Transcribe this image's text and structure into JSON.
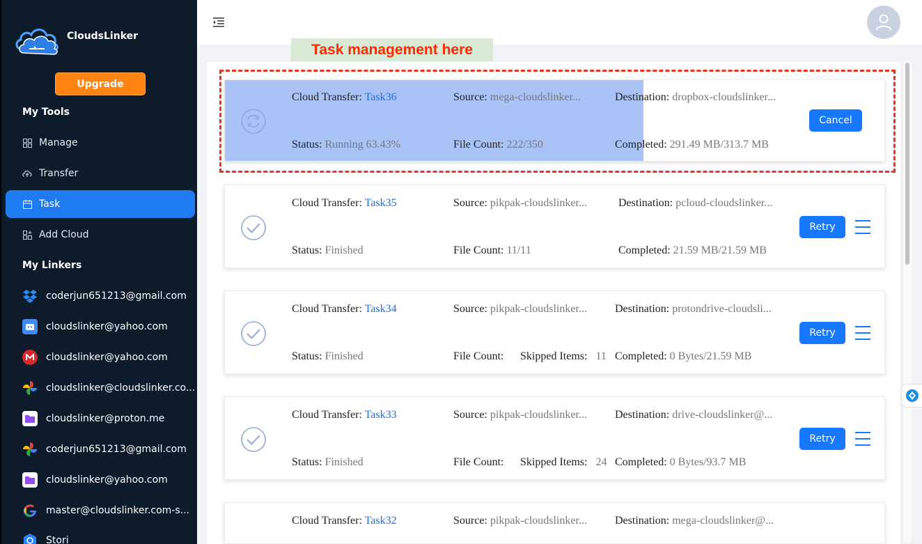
{
  "app": {
    "brand": "CloudsLinker",
    "upgrade_label": "Upgrade"
  },
  "sidebar": {
    "tools_title": "My Tools",
    "tools": [
      {
        "label": "Manage",
        "icon": "grid-icon"
      },
      {
        "label": "Transfer",
        "icon": "cloud-transfer-icon"
      },
      {
        "label": "Task",
        "icon": "calendar-icon",
        "active": true
      },
      {
        "label": "Add Cloud",
        "icon": "add-grid-icon"
      }
    ],
    "linkers_title": "My Linkers",
    "linkers": [
      {
        "label": "coderjun651213@gmail.com",
        "icon": "dropbox-icon"
      },
      {
        "label": "cloudslinker@yahoo.com",
        "icon": "pikpak-icon"
      },
      {
        "label": "cloudslinker@yahoo.com",
        "icon": "mega-icon"
      },
      {
        "label": "cloudslinker@cloudslinker.co...",
        "icon": "google-photos-icon"
      },
      {
        "label": "cloudslinker@proton.me",
        "icon": "proton-drive-icon"
      },
      {
        "label": "coderjun651213@gmail.com",
        "icon": "google-photos-icon"
      },
      {
        "label": "cloudslinker@yahoo.com",
        "icon": "proton-drive-icon"
      },
      {
        "label": "master@cloudslinker.com-s...",
        "icon": "google-icon"
      },
      {
        "label": "Stori",
        "icon": "storj-icon"
      }
    ]
  },
  "annotation": {
    "banner": "Task management here"
  },
  "labels": {
    "cloud_transfer": "Cloud Transfer: ",
    "source": "Source: ",
    "destination": "Destination: ",
    "status": "Status: ",
    "file_count": "File Count: ",
    "skipped_items": "Skipped Items:",
    "completed": "Completed: "
  },
  "tasks": [
    {
      "name": "Task36",
      "source": "mega-cloudslinker...",
      "destination": "dropbox-cloudslinker...",
      "status": "Running 63.43%",
      "progress": 0.6343,
      "file_count": "222/350",
      "skipped": "",
      "completed": "291.49 MB/313.7 MB",
      "action": "Cancel"
    },
    {
      "name": "Task35",
      "source": "pikpak-cloudslinker...",
      "destination": "pcloud-cloudslinker...",
      "status": "Finished",
      "file_count": "11/11",
      "skipped": "",
      "completed": "21.59 MB/21.59 MB",
      "action": "Retry"
    },
    {
      "name": "Task34",
      "source": "pikpak-cloudslinker...",
      "destination": "protondrive-cloudsli...",
      "status": "Finished",
      "file_count": "",
      "skipped": "11",
      "completed": "0 Bytes/21.59 MB",
      "action": "Retry"
    },
    {
      "name": "Task33",
      "source": "pikpak-cloudslinker...",
      "destination": "drive-cloudslinker@...",
      "status": "Finished",
      "file_count": "",
      "skipped": "24",
      "completed": "0 Bytes/93.7 MB",
      "action": "Retry"
    },
    {
      "name": "Task32",
      "source": "pikpak-cloudslinker...",
      "destination": "mega-cloudslinker@...",
      "status": "",
      "file_count": "",
      "skipped": "",
      "completed": "",
      "action": ""
    }
  ],
  "colors": {
    "sidebar_bg": "#0d1b2a",
    "accent": "#1677ff",
    "upgrade": "#ff8412",
    "annotation": "#e8341c"
  }
}
